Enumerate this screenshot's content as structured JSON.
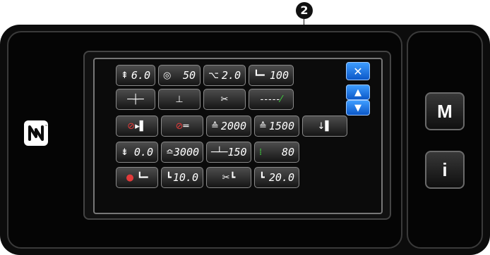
{
  "callout": {
    "label": "2"
  },
  "side": {
    "menu_label": "M",
    "info_label": "i"
  },
  "nfc": {
    "icon": "nfc-icon"
  },
  "grid": {
    "r1": [
      {
        "name": "stitch-length-button",
        "icon": "stitch-length-icon",
        "value": "6.0"
      },
      {
        "name": "thread-tension-button",
        "icon": "tension-dial-icon",
        "value": "50"
      },
      {
        "name": "feed-amount-button",
        "icon": "feed-icon",
        "value": "2.0"
      },
      {
        "name": "presser-foot-pressure-button",
        "icon": "presser-foot-icon",
        "value": "100"
      }
    ],
    "r3": [
      {
        "name": "wiper-off-button",
        "icon": "wiper-disabled-icon"
      },
      {
        "name": "thread-trim-off-button",
        "icon": "trim-disabled-icon"
      },
      {
        "name": "speed-max-button",
        "icon": "speed-icon",
        "value": "2000"
      },
      {
        "name": "speed-min-button",
        "icon": "speed-low-icon",
        "value": "1500"
      },
      {
        "name": "reverse-feed-button",
        "icon": "reverse-feed-icon"
      }
    ],
    "r4": [
      {
        "name": "needle-gap-button",
        "icon": "needle-gap-icon",
        "value": "0.0"
      },
      {
        "name": "sewing-speed-button",
        "icon": "sewing-speed-icon",
        "value": "3000"
      },
      {
        "name": "needle-position-button",
        "icon": "needle-position-icon",
        "value": "150"
      },
      {
        "name": "count-button",
        "icon": "count-icon",
        "value": "80"
      }
    ],
    "r5": [
      {
        "name": "foot-lift-off-button",
        "icon": "foot-lift-disabled-icon"
      },
      {
        "name": "foot-lift-height-button",
        "icon": "foot-lift-icon",
        "value": "10.0"
      },
      {
        "name": "trim-foot-button",
        "icon": "trim-foot-icon"
      },
      {
        "name": "foot-height-button",
        "icon": "foot-height-icon",
        "value": "20.0"
      }
    ]
  },
  "nav": {
    "close": "close-icon",
    "up": "up-arrow-icon",
    "down": "down-arrow-icon"
  }
}
